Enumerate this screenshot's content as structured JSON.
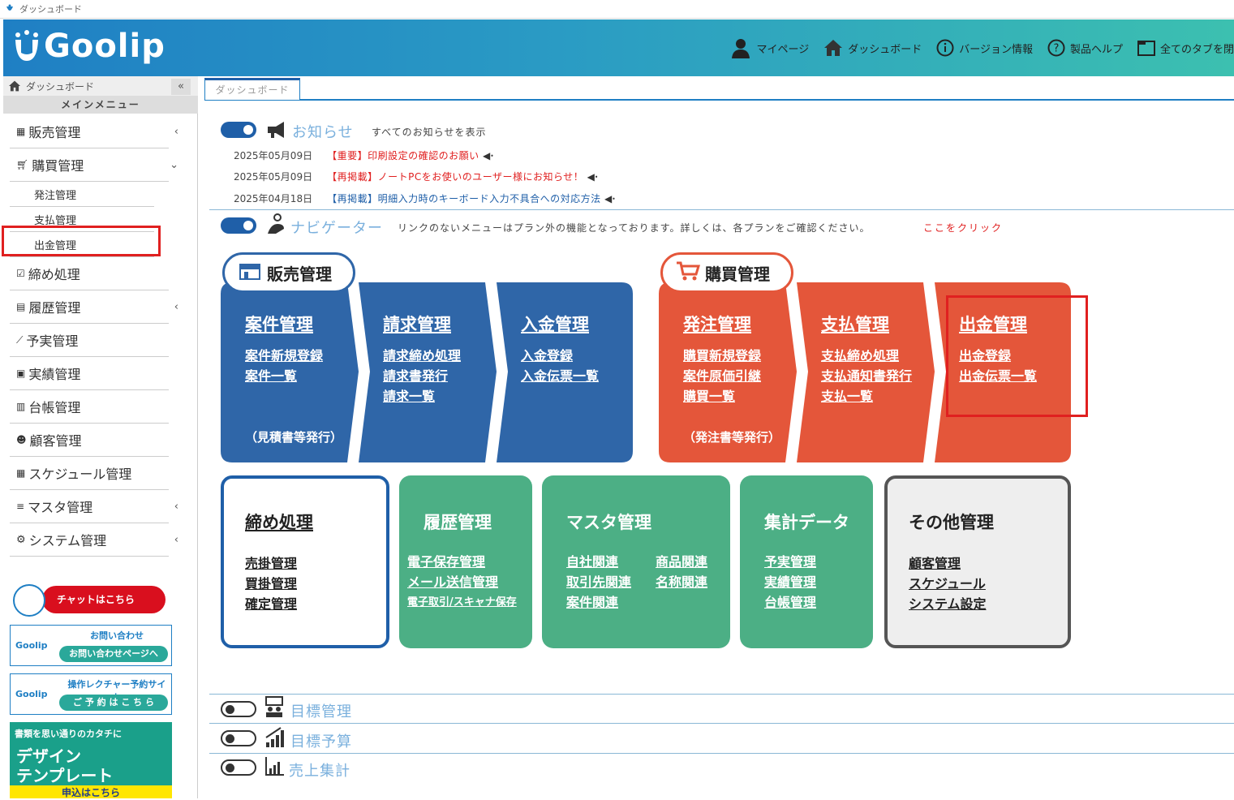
{
  "window_title": "ダッシュボード",
  "app": {
    "logo": "Goolip"
  },
  "topnav": [
    {
      "label": "マイページ",
      "icon": "user-icon"
    },
    {
      "label": "ダッシュボード",
      "icon": "home-icon"
    },
    {
      "label": "バージョン情報",
      "icon": "info-icon"
    },
    {
      "label": "製品ヘルプ",
      "icon": "help-icon"
    },
    {
      "label": "全てのタブを閉",
      "icon": "window-icon"
    }
  ],
  "sidebar": {
    "breadcrumb": "ダッシュボード",
    "collapse": "«",
    "main_menu": "メインメニュー",
    "items": [
      {
        "label": "販売管理",
        "icon": "store-icon",
        "chevron": "‹"
      },
      {
        "label": "購買管理",
        "icon": "cart-icon",
        "chevron": "⌄"
      },
      {
        "label": "締め処理",
        "icon": "checkbox-icon",
        "chevron": ""
      },
      {
        "label": "履歴管理",
        "icon": "history-icon",
        "chevron": "‹"
      },
      {
        "label": "予実管理",
        "icon": "chart-icon",
        "chevron": ""
      },
      {
        "label": "実績管理",
        "icon": "bookmark-icon",
        "chevron": ""
      },
      {
        "label": "台帳管理",
        "icon": "ledger-icon",
        "chevron": ""
      },
      {
        "label": "顧客管理",
        "icon": "people-icon",
        "chevron": ""
      },
      {
        "label": "スケジュール管理",
        "icon": "calendar-icon",
        "chevron": ""
      },
      {
        "label": "マスタ管理",
        "icon": "database-icon",
        "chevron": "‹"
      },
      {
        "label": "システム管理",
        "icon": "gear-icon",
        "chevron": "‹"
      }
    ],
    "purchase_sub": [
      "発注管理",
      "支払管理",
      "出金管理"
    ],
    "chat": "チャットはこちら",
    "inquiry": {
      "logo": "Goolip",
      "title": "お問い合わせ",
      "button": "お問い合わせページへ"
    },
    "lecture": {
      "logo": "Goolip",
      "title": "操作レクチャー予約サイト",
      "button": "ご 予 約 は こ ち ら"
    },
    "banner": {
      "line1": "書類を思い通りのカタチに",
      "line2": "デザイン",
      "line3": "テンプレート",
      "line4": "申込はこちら"
    }
  },
  "tab": "ダッシュボード",
  "news": {
    "title": "お知らせ",
    "show_all": "すべてのお知らせを表示",
    "items": [
      {
        "date": "2025年05月09日",
        "tag": "【重要】",
        "text": "印刷設定の確認のお願い",
        "color": "#e02020"
      },
      {
        "date": "2025年05月09日",
        "tag": "【再掲載】",
        "text": "ノートPCをお使いのユーザー様にお知らせ！",
        "color": "#e02020"
      },
      {
        "date": "2025年04月18日",
        "tag": "【再掲載】",
        "text": "明細入力時のキーボード入力不具合への対応方法",
        "color": "#1f5fa8"
      }
    ]
  },
  "navigator": {
    "title": "ナビゲーター",
    "note": "リンクのないメニューはプラン外の機能となっております。詳しくは、各プランをご確認ください。",
    "click_here": "ここをクリック"
  },
  "sales": {
    "label": "販売管理",
    "color": "#2f66a8",
    "steps": [
      {
        "title": "案件管理",
        "links": [
          "案件新規登録",
          "案件一覧"
        ],
        "note": "（見積書等発行）"
      },
      {
        "title": "請求管理",
        "links": [
          "請求締め処理",
          "請求書発行",
          "請求一覧"
        ],
        "note": ""
      },
      {
        "title": "入金管理",
        "links": [
          "入金登録",
          "入金伝票一覧"
        ],
        "note": ""
      }
    ]
  },
  "purchase": {
    "label": "購買管理",
    "color": "#e4563a",
    "steps": [
      {
        "title": "発注管理",
        "links": [
          "購買新規登録",
          "案件原価引継",
          "購買一覧"
        ],
        "note": "（発注書等発行）"
      },
      {
        "title": "支払管理",
        "links": [
          "支払締め処理",
          "支払通知書発行",
          "支払一覧"
        ],
        "note": ""
      },
      {
        "title": "出金管理",
        "links": [
          "出金登録",
          "出金伝票一覧"
        ],
        "note": ""
      }
    ]
  },
  "boxes": [
    {
      "title": "締め処理",
      "links": [
        "売掛管理",
        "買掛管理",
        "確定管理"
      ]
    },
    {
      "title": "履歴管理",
      "links": [
        "電子保存管理",
        "メール送信管理",
        "電子取引/スキャナ保存"
      ]
    },
    {
      "title": "マスタ管理",
      "links": [
        "自社関連",
        "取引先関連",
        "案件関連",
        "商品関連",
        "名称関連"
      ]
    },
    {
      "title": "集計データ",
      "links": [
        "予実管理",
        "実績管理",
        "台帳管理"
      ]
    },
    {
      "title": "その他管理",
      "links": [
        "顧客管理",
        "スケジュール",
        "システム設定"
      ]
    }
  ],
  "collapsed_sections": [
    "目標管理",
    "目標予算",
    "売上集計"
  ]
}
